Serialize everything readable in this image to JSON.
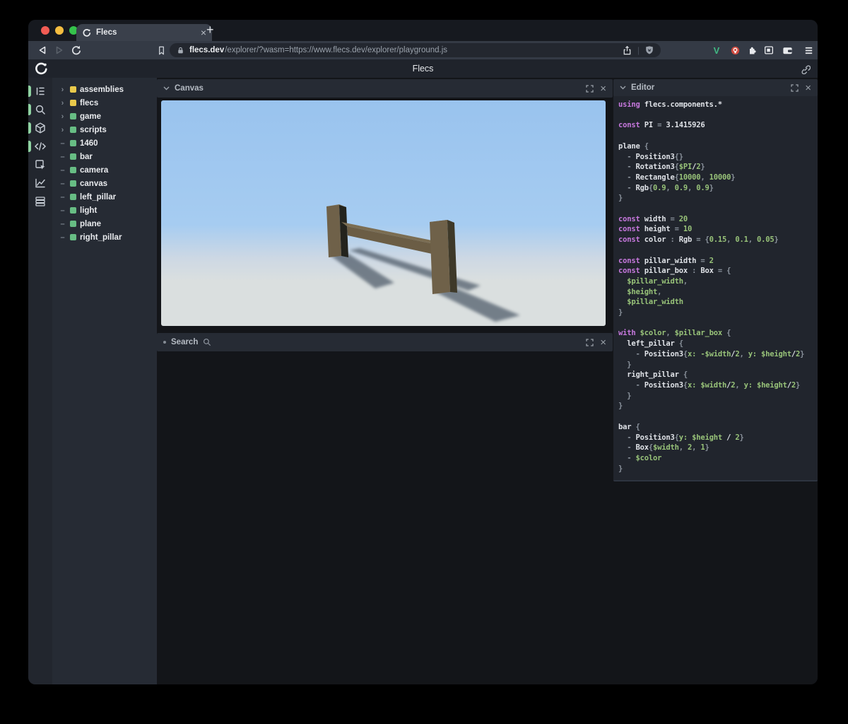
{
  "browser": {
    "tab_title": "Flecs",
    "new_tab_label": "+",
    "url_host": "flecs.dev",
    "url_path": "/explorer/?wasm=https://www.flecs.dev/explorer/playground.js",
    "extension_v_label": "V"
  },
  "header": {
    "title": "Flecs"
  },
  "sidebar": {
    "icons": [
      {
        "name": "entity-tree",
        "active": true
      },
      {
        "name": "query-search",
        "active": true
      },
      {
        "name": "entities-cube",
        "active": true
      },
      {
        "name": "script-code",
        "active": true
      },
      {
        "name": "inspector",
        "active": false
      },
      {
        "name": "stats-chart",
        "active": false
      },
      {
        "name": "storage",
        "active": false
      }
    ]
  },
  "tree": {
    "items": [
      {
        "label": "assemblies",
        "type": "module",
        "expandable": true
      },
      {
        "label": "flecs",
        "type": "module",
        "expandable": true
      },
      {
        "label": "game",
        "type": "entity",
        "expandable": true
      },
      {
        "label": "scripts",
        "type": "entity",
        "expandable": true
      },
      {
        "label": "1460",
        "type": "entity",
        "expandable": false
      },
      {
        "label": "bar",
        "type": "entity",
        "expandable": false
      },
      {
        "label": "camera",
        "type": "entity",
        "expandable": false
      },
      {
        "label": "canvas",
        "type": "entity",
        "expandable": false
      },
      {
        "label": "left_pillar",
        "type": "entity",
        "expandable": false
      },
      {
        "label": "light",
        "type": "entity",
        "expandable": false
      },
      {
        "label": "plane",
        "type": "entity",
        "expandable": false
      },
      {
        "label": "right_pillar",
        "type": "entity",
        "expandable": false
      }
    ]
  },
  "panels": {
    "canvas": {
      "title": "Canvas"
    },
    "search": {
      "title": "Search"
    },
    "editor": {
      "title": "Editor",
      "code_lines": [
        [
          [
            "k",
            "using"
          ],
          [
            "w",
            " flecs.components.*"
          ]
        ],
        [],
        [
          [
            "k",
            "const"
          ],
          [
            "w",
            " PI "
          ],
          [
            "p",
            "= "
          ],
          [
            "w",
            "3.1415926"
          ]
        ],
        [],
        [
          [
            "w",
            "plane "
          ],
          [
            "p",
            "{"
          ]
        ],
        [
          [
            "p",
            "  - "
          ],
          [
            "w",
            "Position3"
          ],
          [
            "p",
            "{}"
          ]
        ],
        [
          [
            "p",
            "  - "
          ],
          [
            "w",
            "Rotation3"
          ],
          [
            "p",
            "{"
          ],
          [
            "g",
            "$PI"
          ],
          [
            "w",
            "/"
          ],
          [
            "g",
            "2"
          ],
          [
            "p",
            "}"
          ]
        ],
        [
          [
            "p",
            "  - "
          ],
          [
            "w",
            "Rectangle"
          ],
          [
            "p",
            "{"
          ],
          [
            "g",
            "10000"
          ],
          [
            "p",
            ", "
          ],
          [
            "g",
            "10000"
          ],
          [
            "p",
            "}"
          ]
        ],
        [
          [
            "p",
            "  - "
          ],
          [
            "w",
            "Rgb"
          ],
          [
            "p",
            "{"
          ],
          [
            "g",
            "0.9"
          ],
          [
            "p",
            ", "
          ],
          [
            "g",
            "0.9"
          ],
          [
            "p",
            ", "
          ],
          [
            "g",
            "0.9"
          ],
          [
            "p",
            "}"
          ]
        ],
        [
          [
            "p",
            "}"
          ]
        ],
        [],
        [
          [
            "k",
            "const"
          ],
          [
            "w",
            " width "
          ],
          [
            "p",
            "= "
          ],
          [
            "g",
            "20"
          ]
        ],
        [
          [
            "k",
            "const"
          ],
          [
            "w",
            " height "
          ],
          [
            "p",
            "= "
          ],
          [
            "g",
            "10"
          ]
        ],
        [
          [
            "k",
            "const"
          ],
          [
            "w",
            " color "
          ],
          [
            "p",
            ": "
          ],
          [
            "w",
            "Rgb "
          ],
          [
            "p",
            "= {"
          ],
          [
            "g",
            "0.15"
          ],
          [
            "p",
            ", "
          ],
          [
            "g",
            "0.1"
          ],
          [
            "p",
            ", "
          ],
          [
            "g",
            "0.05"
          ],
          [
            "p",
            "}"
          ]
        ],
        [],
        [
          [
            "k",
            "const"
          ],
          [
            "w",
            " pillar_width "
          ],
          [
            "p",
            "= "
          ],
          [
            "g",
            "2"
          ]
        ],
        [
          [
            "k",
            "const"
          ],
          [
            "w",
            " pillar_box "
          ],
          [
            "p",
            ": "
          ],
          [
            "w",
            "Box "
          ],
          [
            "p",
            "= {"
          ]
        ],
        [
          [
            "g",
            "  $pillar_width"
          ],
          [
            "p",
            ","
          ]
        ],
        [
          [
            "g",
            "  $height"
          ],
          [
            "p",
            ","
          ]
        ],
        [
          [
            "g",
            "  $pillar_width"
          ]
        ],
        [
          [
            "p",
            "}"
          ]
        ],
        [],
        [
          [
            "k",
            "with"
          ],
          [
            "g",
            " $color"
          ],
          [
            "p",
            ", "
          ],
          [
            "g",
            "$pillar_box"
          ],
          [
            "p",
            " {"
          ]
        ],
        [
          [
            "w",
            "  left_pillar "
          ],
          [
            "p",
            "{"
          ]
        ],
        [
          [
            "p",
            "    - "
          ],
          [
            "w",
            "Position3"
          ],
          [
            "p",
            "{"
          ],
          [
            "g",
            "x: -$width"
          ],
          [
            "w",
            "/"
          ],
          [
            "g",
            "2"
          ],
          [
            "p",
            ", "
          ],
          [
            "g",
            "y: $height"
          ],
          [
            "w",
            "/"
          ],
          [
            "g",
            "2"
          ],
          [
            "p",
            "}"
          ]
        ],
        [
          [
            "p",
            "  }"
          ]
        ],
        [
          [
            "w",
            "  right_pillar "
          ],
          [
            "p",
            "{"
          ]
        ],
        [
          [
            "p",
            "    - "
          ],
          [
            "w",
            "Position3"
          ],
          [
            "p",
            "{"
          ],
          [
            "g",
            "x: $width"
          ],
          [
            "w",
            "/"
          ],
          [
            "g",
            "2"
          ],
          [
            "p",
            ", "
          ],
          [
            "g",
            "y: $height"
          ],
          [
            "w",
            "/"
          ],
          [
            "g",
            "2"
          ],
          [
            "p",
            "}"
          ]
        ],
        [
          [
            "p",
            "  }"
          ]
        ],
        [
          [
            "p",
            "}"
          ]
        ],
        [],
        [
          [
            "w",
            "bar "
          ],
          [
            "p",
            "{"
          ]
        ],
        [
          [
            "p",
            "  - "
          ],
          [
            "w",
            "Position3"
          ],
          [
            "p",
            "{"
          ],
          [
            "g",
            "y: $height "
          ],
          [
            "w",
            "/ "
          ],
          [
            "g",
            "2"
          ],
          [
            "p",
            "}"
          ]
        ],
        [
          [
            "p",
            "  - "
          ],
          [
            "w",
            "Box"
          ],
          [
            "p",
            "{"
          ],
          [
            "g",
            "$width"
          ],
          [
            "p",
            ", "
          ],
          [
            "g",
            "2"
          ],
          [
            "p",
            ", "
          ],
          [
            "g",
            "1"
          ],
          [
            "p",
            "}"
          ]
        ],
        [
          [
            "p",
            "  - "
          ],
          [
            "g",
            "$color"
          ]
        ],
        [
          [
            "p",
            "}"
          ]
        ]
      ]
    }
  },
  "scene": {
    "sky_top": "#99c3ee",
    "sky_low": "#a6ccf1",
    "horizon": "#cdd8e4",
    "ground": "#dadfdf",
    "wood_top": "#7d7157",
    "wood_light": "#6f6149",
    "wood_dark_side": "#23231d",
    "wood_mid_side": "#3e3929",
    "bar_top": "#7b6d52",
    "bar_front": "#6b5d45",
    "shadow": "#5a6673"
  },
  "colors": {
    "active_pill": "#8fd3a2",
    "module_yellow": "#e9c94b",
    "entity_green": "#67bd84",
    "keyword_purple": "#c678dd",
    "value_green": "#98c379",
    "vue_green": "#41b883",
    "ext_red": "#cf4a3f"
  }
}
